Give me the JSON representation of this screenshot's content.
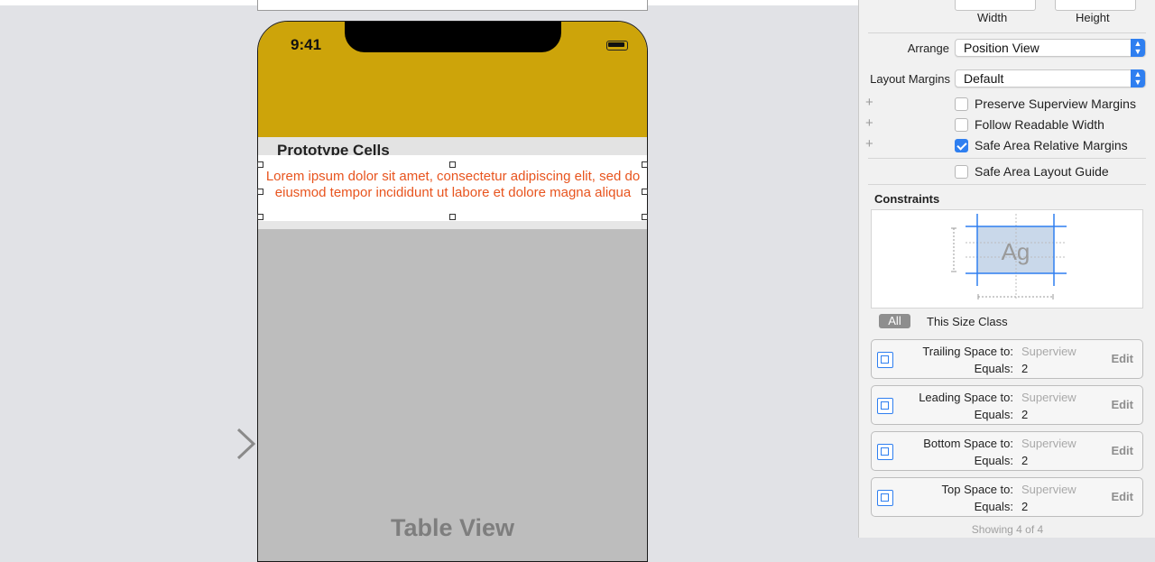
{
  "canvas": {
    "phone": {
      "status_time": "9:41",
      "section_header": "Prototype Cells",
      "cell_text": "Lorem ipsum dolor sit amet, consectetur adipiscing elit, sed do eiusmod tempor incididunt ut labore et dolore magna aliqua",
      "table_view_label": "Table View"
    },
    "colors": {
      "header_bg": "#cda40a",
      "cell_text": "#e8541e",
      "table_bg": "#bdbdbd"
    }
  },
  "inspector": {
    "size": {
      "width_label": "Width",
      "height_label": "Height"
    },
    "arrange": {
      "label": "Arrange",
      "value": "Position View"
    },
    "layout_margins": {
      "label": "Layout Margins",
      "value": "Default"
    },
    "checkboxes": [
      {
        "label": "Preserve Superview Margins",
        "checked": false
      },
      {
        "label": "Follow Readable Width",
        "checked": false
      },
      {
        "label": "Safe Area Relative Margins",
        "checked": true
      },
      {
        "label": "Safe Area Layout Guide",
        "checked": false
      }
    ],
    "constraints": {
      "title": "Constraints",
      "preview_text": "Ag",
      "tab_all": "All",
      "tab_size_class": "This Size Class",
      "rows": [
        {
          "title": "Trailing Space to:",
          "target": "Superview",
          "equals_label": "Equals:",
          "value": "2",
          "edit": "Edit",
          "icon": "trailing-space-icon"
        },
        {
          "title": "Leading Space to:",
          "target": "Superview",
          "equals_label": "Equals:",
          "value": "2",
          "edit": "Edit",
          "icon": "leading-space-icon"
        },
        {
          "title": "Bottom Space to:",
          "target": "Superview",
          "equals_label": "Equals:",
          "value": "2",
          "edit": "Edit",
          "icon": "bottom-space-icon"
        },
        {
          "title": "Top Space to:",
          "target": "Superview",
          "equals_label": "Equals:",
          "value": "2",
          "edit": "Edit",
          "icon": "top-space-icon"
        }
      ],
      "showing": "Showing 4 of 4"
    },
    "accent_color": "#2f7ff0"
  }
}
